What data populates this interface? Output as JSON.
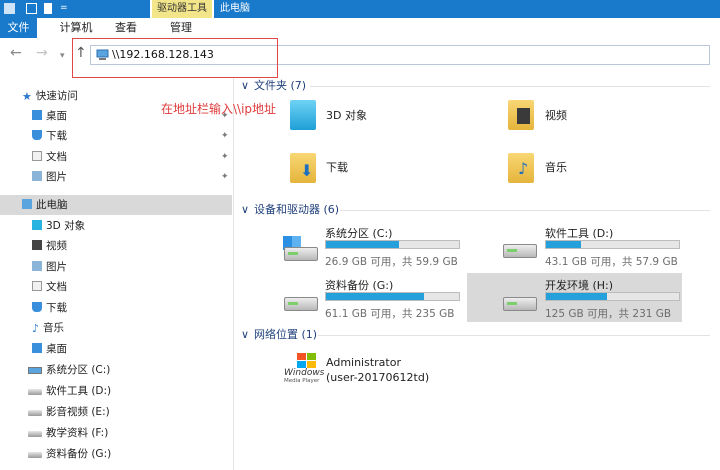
{
  "titlebar": {
    "context_tab": "驱动器工具",
    "window_title": "此电脑"
  },
  "ribbon": {
    "tabs": [
      "文件",
      "计算机",
      "查看",
      "管理"
    ]
  },
  "address": {
    "value": "\\\\192.168.128.143"
  },
  "annotation": "在地址栏输入\\\\ip地址",
  "sidebar": {
    "quick_access": "快速访问",
    "quick_items": [
      "桌面",
      "下载",
      "文档",
      "图片"
    ],
    "this_pc": "此电脑",
    "pc_items": [
      "3D 对象",
      "视频",
      "图片",
      "文档",
      "下载",
      "音乐",
      "桌面",
      "系统分区 (C:)",
      "软件工具 (D:)",
      "影音视频 (E:)",
      "教学资料 (F:)",
      "资料备份 (G:)"
    ]
  },
  "groups": {
    "folders": "文件夹 (7)",
    "devices": "设备和驱动器 (6)",
    "network": "网络位置 (1)"
  },
  "folders": [
    "3D 对象",
    "视频",
    "下载",
    "音乐"
  ],
  "drives": [
    {
      "name": "系统分区 (C:)",
      "free": "26.9 GB 可用，共 59.9 GB",
      "used_fraction": 0.55
    },
    {
      "name": "软件工具 (D:)",
      "free": "43.1 GB 可用，共 57.9 GB",
      "used_fraction": 0.26
    },
    {
      "name": "资料备份 (G:)",
      "free": "61.1 GB 可用，共 235 GB",
      "used_fraction": 0.74
    },
    {
      "name": "开发环境 (H:)",
      "free": "125 GB 可用，共 231 GB",
      "used_fraction": 0.46
    }
  ],
  "network_item": {
    "name": "Administrator",
    "host": "(user-20170612td)",
    "logo_text": "Windows",
    "logo_sub": "Media Player"
  },
  "colors": {
    "accent": "#1979ca",
    "tools_tab": "#f3e68a",
    "bar": "#26a0da",
    "annotation": "#e03b3b"
  }
}
